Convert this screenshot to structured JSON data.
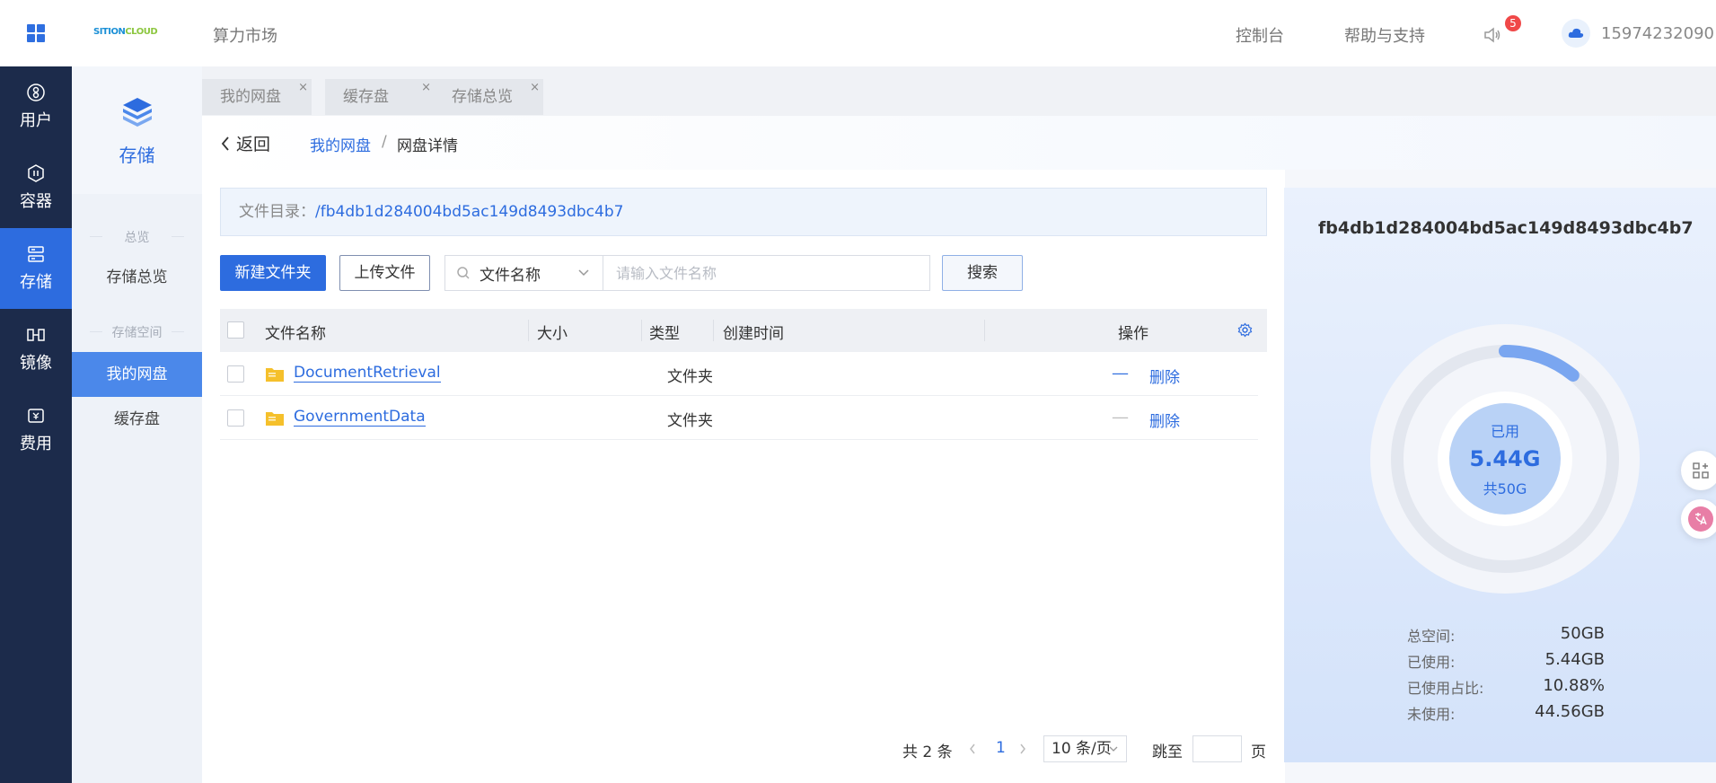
{
  "header": {
    "nav_market": "算力市场",
    "console": "控制台",
    "help": "帮助与支持",
    "notification_count": "5",
    "phone": "15974232090",
    "logo_text_left": "SITION",
    "logo_text_right": "CLOUD"
  },
  "rail": {
    "items": [
      {
        "label": "用户",
        "icon": "user-icon"
      },
      {
        "label": "容器",
        "icon": "container-icon"
      },
      {
        "label": "存储",
        "icon": "storage-icon"
      },
      {
        "label": "镜像",
        "icon": "image-icon"
      },
      {
        "label": "费用",
        "icon": "fee-icon"
      }
    ],
    "active": "存储"
  },
  "sidebar": {
    "title": "存储",
    "group1": "总览",
    "item_overview": "存储总览",
    "group2": "存储空间",
    "item_mydisk": "我的网盘",
    "item_cache": "缓存盘"
  },
  "tabs": [
    {
      "label": "我的网盘"
    },
    {
      "label": "缓存盘"
    },
    {
      "label": "存储总览"
    }
  ],
  "breadcrumb": {
    "back": "返回",
    "parent": "我的网盘",
    "separator": "/",
    "current": "网盘详情"
  },
  "directory": {
    "label": "文件目录：",
    "path": "/fb4db1d284004bd5ac149d8493dbc4b7"
  },
  "toolbar": {
    "new_folder": "新建文件夹",
    "upload": "上传文件",
    "search_field": "文件名称",
    "search_placeholder": "请输入文件名称",
    "search_button": "搜索"
  },
  "table": {
    "columns": [
      "文件名称",
      "大小",
      "类型",
      "创建时间",
      "操作"
    ],
    "rows": [
      {
        "name": "DocumentRetrieval",
        "size": "",
        "type": "文件夹",
        "created": "",
        "dash": "__",
        "delete": "删除"
      },
      {
        "name": "GovernmentData",
        "size": "",
        "type": "文件夹",
        "created": "",
        "dash": "__",
        "delete": "删除"
      }
    ]
  },
  "pager": {
    "total": "共 2 条",
    "current_page": "1",
    "page_size": "10 条/页",
    "jump_label": "跳至",
    "page_suffix": "页"
  },
  "usage": {
    "title": "fb4db1d284004bd5ac149d8493dbc4b7",
    "used_label": "已用",
    "used_value": "5.44G",
    "total_label": "共50G",
    "used_fraction": 0.1088,
    "stats": [
      {
        "key": "总空间:",
        "value": "50GB"
      },
      {
        "key": "已使用:",
        "value": "5.44GB"
      },
      {
        "key": "已使用占比:",
        "value": "10.88%"
      },
      {
        "key": "未使用:",
        "value": "44.56GB"
      }
    ]
  },
  "colors": {
    "primary": "#2d6cdf",
    "rail_bg": "#1c2b4b",
    "folder": "#f5c02b",
    "badge": "#f04848"
  }
}
